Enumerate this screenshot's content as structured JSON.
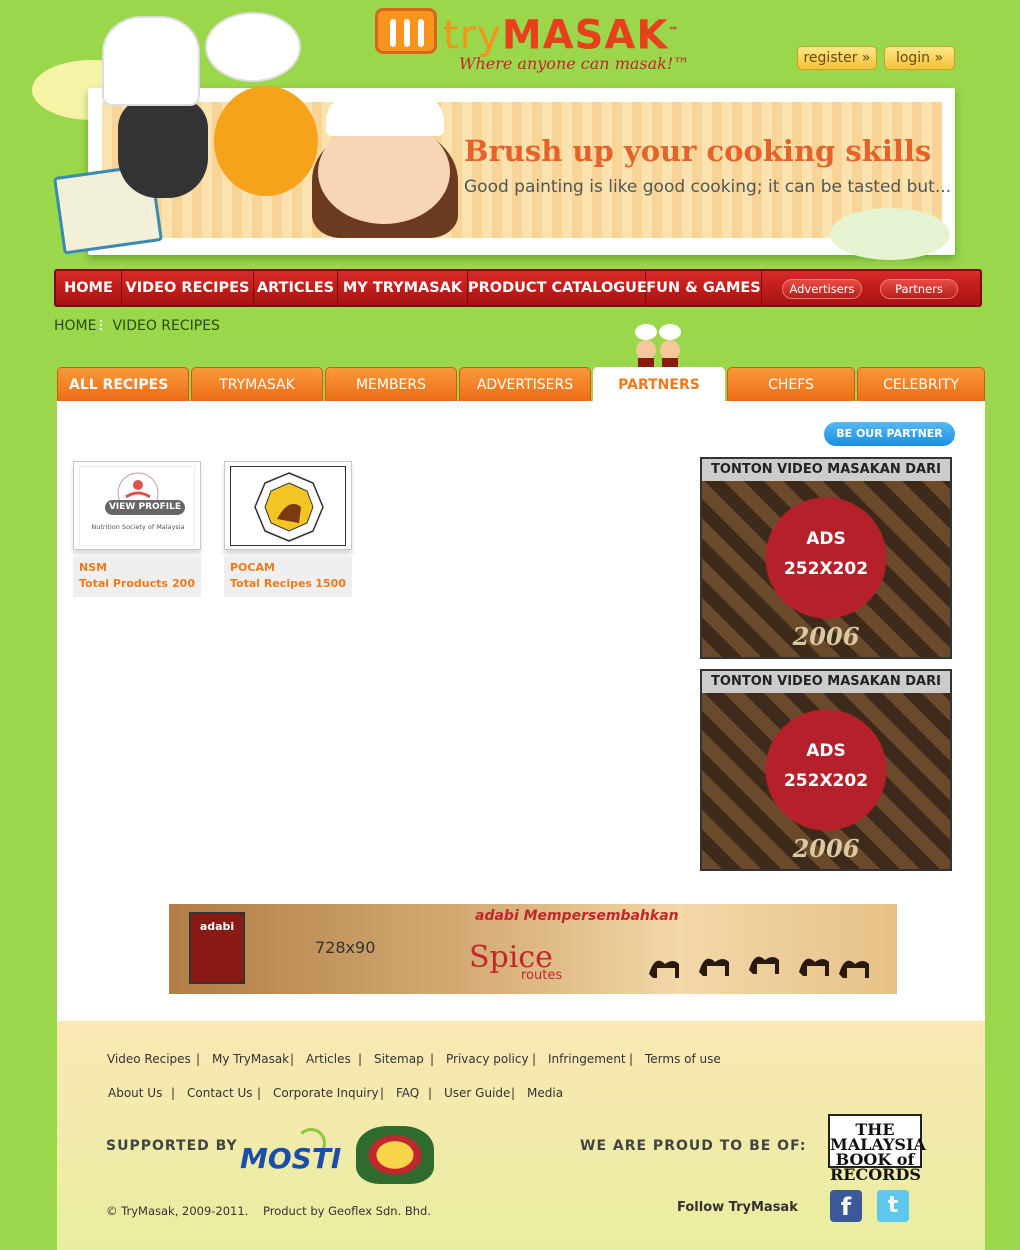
{
  "brand": {
    "logo_try": "try",
    "logo_masak": "MASAK",
    "trademark": "™",
    "tagline": "Where anyone can masak!™"
  },
  "auth": {
    "register": "register »",
    "login": "login »"
  },
  "hero": {
    "title": "Brush up your cooking skills",
    "subtitle": "Good painting is like good cooking; it can be tasted but..."
  },
  "nav": {
    "items": [
      "HOME",
      "VIDEO RECIPES",
      "ARTICLES",
      "MY TRYMASAK",
      "PRODUCT CATALOGUE",
      "FUN & GAMES"
    ],
    "pills": [
      "Advertisers",
      "Partners"
    ]
  },
  "breadcrumb": {
    "home": "HOME",
    "current": "VIDEO RECIPES"
  },
  "tabs": [
    "ALL RECIPES",
    "TRYMASAK",
    "MEMBERS",
    "ADVERTISERS",
    "PARTNERS",
    "CHEFS",
    "CELEBRITY"
  ],
  "active_tab": "PARTNERS",
  "be_partner": "BE OUR PARTNER",
  "partners": [
    {
      "name": "NSM",
      "stat_label": "Total Products",
      "stat_value": "200",
      "logo_caption": "Nutrition Society of Malaysia",
      "hover_button": "VIEW PROFILE"
    },
    {
      "name": "POCAM",
      "stat_label": "Total  Recipes",
      "stat_value": "1500"
    }
  ],
  "ads": [
    {
      "strip": "TONTON VIDEO MASAKAN DARI",
      "label1": "ADS",
      "label2": "252X202",
      "year": "2006"
    },
    {
      "strip": "TONTON VIDEO MASAKAN DARI",
      "label1": "ADS",
      "label2": "252X202",
      "year": "2006"
    }
  ],
  "banner_ad": {
    "size": "728x90",
    "brand": "adabi",
    "top": "adabi Mempersembahkan",
    "spice": "Spice",
    "routes": "routes"
  },
  "footer": {
    "row1": [
      "Video Recipes",
      "My TryMasak",
      "Articles",
      "Sitemap",
      "Privacy policy",
      "Infringement",
      "Terms of use"
    ],
    "row2": [
      "About Us",
      "Contact Us",
      "Corporate Inquiry",
      "FAQ",
      "User Guide",
      "Media"
    ],
    "supported_by": "SUPPORTED BY",
    "mosti": "MOSTI",
    "proud": "WE ARE PROUD TO BE OF:",
    "mbr": "THE MALAYSIA BOOK of RECORDS",
    "copyright": "© TryMasak, 2009-2011.",
    "product_by": "Product by Geoflex Sdn. Bhd.",
    "follow": "Follow TryMasak",
    "facebook": "f",
    "twitter": "t"
  },
  "colors": {
    "page_bg": "#9bd74a",
    "nav_red": "#c81e1c",
    "tab_orange": "#f47f24",
    "accent_orange": "#f07a1a",
    "partner_blue": "#1c8ee0"
  }
}
